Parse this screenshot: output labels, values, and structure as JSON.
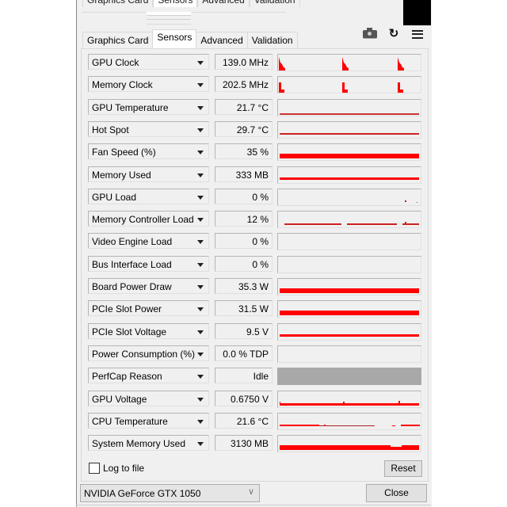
{
  "window": {
    "ghost_tabs": [
      "Graphics Card",
      "Sensors",
      "Advanced",
      "Validation"
    ],
    "tabs": [
      {
        "label": "Graphics Card",
        "active": false
      },
      {
        "label": "Sensors",
        "active": true
      },
      {
        "label": "Advanced",
        "active": false
      },
      {
        "label": "Validation",
        "active": false
      }
    ],
    "toolbar": {
      "screenshot_icon": "camera-icon",
      "refresh_icon": "refresh-icon",
      "menu_icon": "hamburger-menu-icon"
    }
  },
  "accent_color": "#ff0000",
  "sensors": [
    {
      "name": "GPU Clock",
      "value": "139.0 MHz",
      "graph": "spikes"
    },
    {
      "name": "Memory Clock",
      "value": "202.5 MHz",
      "graph": "blocks"
    },
    {
      "name": "GPU Temperature",
      "value": "21.7 °C",
      "graph": "thin-line-low"
    },
    {
      "name": "Hot Spot",
      "value": "29.7 °C",
      "graph": "thin-line-mid"
    },
    {
      "name": "Fan Speed (%)",
      "value": "35 %",
      "graph": "thick-bar"
    },
    {
      "name": "Memory Used",
      "value": "333 MB",
      "graph": "medium-line"
    },
    {
      "name": "GPU Load",
      "value": "0 %",
      "graph": "dots"
    },
    {
      "name": "Memory Controller Load",
      "value": "12 %",
      "graph": "dashed-line"
    },
    {
      "name": "Video Engine Load",
      "value": "0 %",
      "graph": "empty"
    },
    {
      "name": "Bus Interface Load",
      "value": "0 %",
      "graph": "empty"
    },
    {
      "name": "Board Power Draw",
      "value": "35.3 W",
      "graph": "thick-bar"
    },
    {
      "name": "PCIe Slot Power",
      "value": "31.5 W",
      "graph": "thick-bar"
    },
    {
      "name": "PCIe Slot Voltage",
      "value": "9.5 V",
      "graph": "medium-line"
    },
    {
      "name": "Power Consumption (%)",
      "value": "0.0 % TDP",
      "graph": "empty"
    },
    {
      "name": "PerfCap Reason",
      "value": "Idle",
      "graph": "gray"
    },
    {
      "name": "GPU Voltage",
      "value": "0.6750 V",
      "graph": "thin-bar-bottom"
    },
    {
      "name": "CPU Temperature",
      "value": "21.6 °C",
      "graph": "noisy-line"
    },
    {
      "name": "System Memory Used",
      "value": "3130 MB",
      "graph": "thick-bar-bottom"
    }
  ],
  "footer": {
    "log_to_file_label": "Log to file",
    "log_to_file_checked": false,
    "reset_label": "Reset",
    "gpu_selected": "NVIDIA GeForce GTX 1050",
    "close_label": "Close"
  }
}
